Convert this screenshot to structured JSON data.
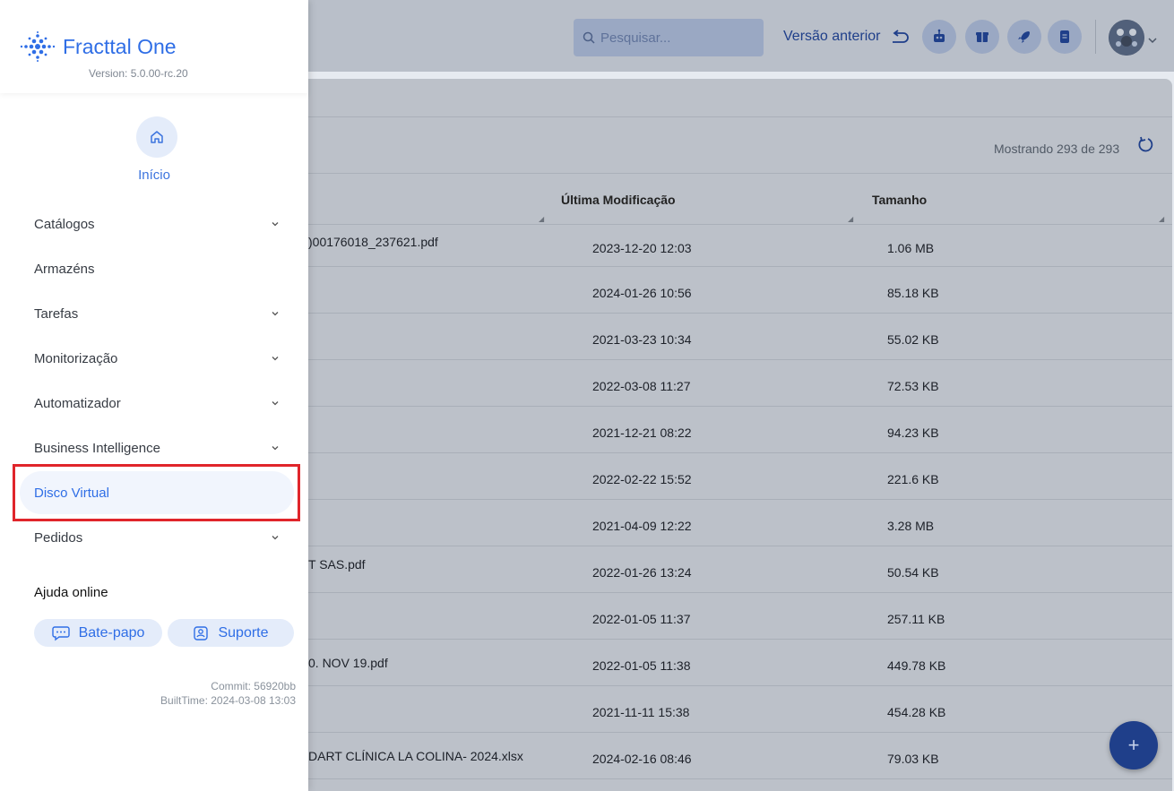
{
  "app": {
    "brand_name": "Fracttal One",
    "version": "Version: 5.0.00-rc.20"
  },
  "header": {
    "search_placeholder": "Pesquisar...",
    "previous_version": "Versão anterior",
    "tool_icons": [
      "robot-icon",
      "gift-icon",
      "rocket-icon",
      "document-icon"
    ]
  },
  "sidebar": {
    "home_label": "Início",
    "items": [
      {
        "label": "Catálogos",
        "has_submenu": true
      },
      {
        "label": "Armazéns",
        "has_submenu": false
      },
      {
        "label": "Tarefas",
        "has_submenu": true
      },
      {
        "label": "Monitorização",
        "has_submenu": true
      },
      {
        "label": "Automatizador",
        "has_submenu": true
      },
      {
        "label": "Business Intelligence",
        "has_submenu": true
      },
      {
        "label": "Disco Virtual",
        "has_submenu": false,
        "active": true
      },
      {
        "label": "Pedidos",
        "has_submenu": true
      }
    ],
    "help": {
      "title": "Ajuda online",
      "chat_label": "Bate-papo",
      "support_label": "Suporte"
    },
    "commit": "Commit: 56920bb",
    "build_time": "BuiltTime: 2024-03-08 13:03"
  },
  "content": {
    "count_text": "Mostrando 293 de 293",
    "columns": [
      "Última Modificação",
      "Tamanho"
    ],
    "rows": [
      {
        "name": ")00176018_237621.pdf",
        "date": "2023-12-20 12:03",
        "size": "1.06 MB"
      },
      {
        "name": "",
        "date": "2024-01-26 10:56",
        "size": "85.18 KB"
      },
      {
        "name": "",
        "date": "2021-03-23 10:34",
        "size": "55.02 KB"
      },
      {
        "name": "",
        "date": "2022-03-08 11:27",
        "size": "72.53 KB"
      },
      {
        "name": "",
        "date": "2021-12-21 08:22",
        "size": "94.23 KB"
      },
      {
        "name": "",
        "date": "2022-02-22 15:52",
        "size": "221.6 KB"
      },
      {
        "name": "",
        "date": "2021-04-09 12:22",
        "size": "3.28 MB"
      },
      {
        "name": "T SAS.pdf",
        "date": "2022-01-26 13:24",
        "size": "50.54 KB"
      },
      {
        "name": "",
        "date": "2022-01-05 11:37",
        "size": "257.11 KB"
      },
      {
        "name": "0. NOV 19.pdf",
        "date": "2022-01-05 11:38",
        "size": "449.78 KB"
      },
      {
        "name": "",
        "date": "2021-11-11 15:38",
        "size": "454.28 KB"
      },
      {
        "name": "DART CLÍNICA LA COLINA- 2024.xlsx",
        "date": "2024-02-16 08:46",
        "size": "79.03 KB"
      }
    ],
    "fab_label": "+"
  },
  "colors": {
    "accent": "#2f6ee6",
    "highlight_border": "#e0252b",
    "overlay_header": "#b9bfc9"
  }
}
